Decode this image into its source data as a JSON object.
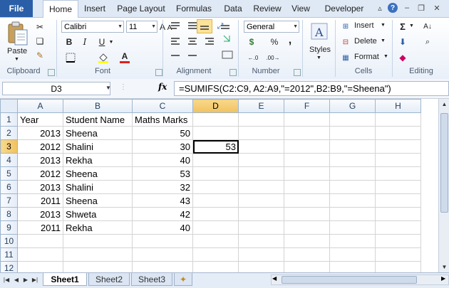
{
  "tabs": {
    "file": "File",
    "items": [
      "Home",
      "Insert",
      "Page Layout",
      "Formulas",
      "Data",
      "Review",
      "View",
      "Developer"
    ],
    "active": "Home"
  },
  "ribbon": {
    "clipboard": {
      "paste": "Paste",
      "label": "Clipboard"
    },
    "font": {
      "name": "Calibri",
      "size": "11",
      "bold": "B",
      "italic": "I",
      "underline": "U",
      "grow": "A",
      "shrink": "A",
      "font_color": "A",
      "label": "Font"
    },
    "alignment": {
      "label": "Alignment"
    },
    "number": {
      "format": "General",
      "currency": "$",
      "percent": "%",
      "comma": ",",
      "label": "Number"
    },
    "styles": {
      "button": "Styles"
    },
    "cells": {
      "insert": "Insert",
      "delete": "Delete",
      "format": "Format",
      "label": "Cells"
    },
    "editing": {
      "sum": "Σ",
      "label": "Editing"
    }
  },
  "formula_bar": {
    "name_box": "D3",
    "fx": "fx",
    "formula": "=SUMIFS(C2:C9, A2:A9,\"=2012\",B2:B9,\"=Sheena\")"
  },
  "grid": {
    "columns": [
      "A",
      "B",
      "C",
      "D",
      "E",
      "F",
      "G",
      "H"
    ],
    "selected_column": "D",
    "selected_row": "3",
    "rows": [
      {
        "n": "1",
        "A": "Year",
        "B": "Student Name",
        "C": "Maths Marks",
        "D": "",
        "E": "",
        "F": "",
        "G": "",
        "H": ""
      },
      {
        "n": "2",
        "A": "2013",
        "B": "Sheena",
        "C": "50",
        "D": "",
        "E": "",
        "F": "",
        "G": "",
        "H": ""
      },
      {
        "n": "3",
        "A": "2012",
        "B": "Shalini",
        "C": "30",
        "D": "53",
        "E": "",
        "F": "",
        "G": "",
        "H": ""
      },
      {
        "n": "4",
        "A": "2013",
        "B": "Rekha",
        "C": "40",
        "D": "",
        "E": "",
        "F": "",
        "G": "",
        "H": ""
      },
      {
        "n": "5",
        "A": "2012",
        "B": "Sheena",
        "C": "53",
        "D": "",
        "E": "",
        "F": "",
        "G": "",
        "H": ""
      },
      {
        "n": "6",
        "A": "2013",
        "B": "Shalini",
        "C": "32",
        "D": "",
        "E": "",
        "F": "",
        "G": "",
        "H": ""
      },
      {
        "n": "7",
        "A": "2011",
        "B": "Sheena",
        "C": "43",
        "D": "",
        "E": "",
        "F": "",
        "G": "",
        "H": ""
      },
      {
        "n": "8",
        "A": "2013",
        "B": "Shweta",
        "C": "42",
        "D": "",
        "E": "",
        "F": "",
        "G": "",
        "H": ""
      },
      {
        "n": "9",
        "A": "2011",
        "B": "Rekha",
        "C": "40",
        "D": "",
        "E": "",
        "F": "",
        "G": "",
        "H": ""
      },
      {
        "n": "10",
        "A": "",
        "B": "",
        "C": "",
        "D": "",
        "E": "",
        "F": "",
        "G": "",
        "H": ""
      },
      {
        "n": "11",
        "A": "",
        "B": "",
        "C": "",
        "D": "",
        "E": "",
        "F": "",
        "G": "",
        "H": ""
      },
      {
        "n": "12",
        "A": "",
        "B": "",
        "C": "",
        "D": "",
        "E": "",
        "F": "",
        "G": "",
        "H": ""
      }
    ]
  },
  "sheets": {
    "items": [
      "Sheet1",
      "Sheet2",
      "Sheet3"
    ],
    "active": "Sheet1"
  }
}
